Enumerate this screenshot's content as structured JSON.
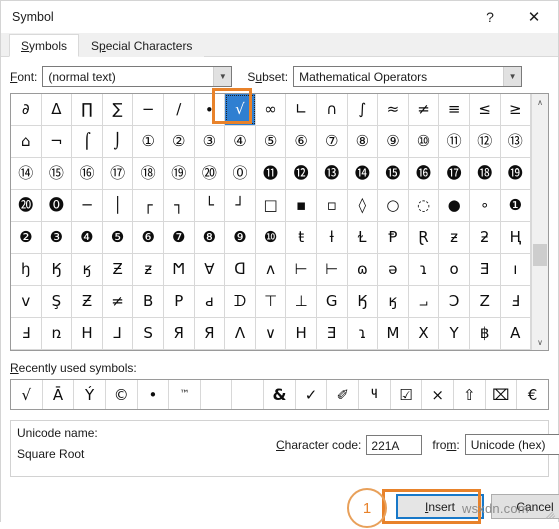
{
  "window": {
    "title": "Symbol",
    "help_icon": "?",
    "close_icon": "✕"
  },
  "tabs": [
    {
      "label": "Symbols",
      "accel": "S",
      "active": true
    },
    {
      "label": "Special Characters",
      "accel": "p",
      "active": false
    }
  ],
  "font_row": {
    "font_label": "Font:",
    "font_accel": "F",
    "font_value": "(normal text)",
    "subset_label": "Subset:",
    "subset_accel": "u",
    "subset_value": "Mathematical Operators",
    "dropdown_icon": "chevron-down-icon"
  },
  "grid": {
    "selected_index": 7,
    "scrollbar": {
      "up_icon": "∧",
      "down_icon": "∨",
      "thumb_position_pct": 60
    },
    "rows": [
      [
        "∂",
        "Δ",
        "∏",
        "∑",
        "−",
        "∕",
        "∙",
        "√",
        "∞",
        "∟",
        "∩",
        "∫",
        "≈",
        "≠",
        "≡",
        "≤",
        "≥"
      ],
      [
        "⌂",
        "¬",
        "⌠",
        "⌡",
        "①",
        "②",
        "③",
        "④",
        "⑤",
        "⑥",
        "⑦",
        "⑧",
        "⑨",
        "⑩",
        "⑪",
        "⑫",
        "⑬"
      ],
      [
        "⑭",
        "⑮",
        "⑯",
        "⑰",
        "⑱",
        "⑲",
        "⑳",
        "⓪",
        "⓫",
        "⓬",
        "⓭",
        "⓮",
        "⓯",
        "⓰",
        "⓱",
        "⓲",
        "⓳"
      ],
      [
        "⓴",
        "⓿",
        "─",
        "│",
        "┌",
        "┐",
        "└",
        "┘",
        "□",
        "▪",
        "▫",
        "◊",
        "○",
        "◌",
        "●",
        "∘",
        "❶"
      ],
      [
        "❷",
        "❸",
        "❹",
        "❺",
        "❻",
        "❼",
        "❽",
        "❾",
        "❿",
        "ŧ",
        "ƚ",
        "Ɫ",
        "Ᵽ",
        "Ɽ",
        "ƶ",
        "ƻ",
        "Ң"
      ],
      [
        "ꜧ",
        "Ӄ",
        "ӄ",
        "Ƶ",
        "ƶ",
        "Ϻ",
        "∀",
        "ᗡ",
        "ʌ",
        "⊢",
        "⊢",
        "ɷ",
        "ǝ",
        "ɿ",
        "ᴏ",
        "Ǝ",
        "ı"
      ],
      [
        "ᴠ",
        "Ş",
        "Ƶ",
        "≠",
        "B",
        "P",
        "ԁ",
        "ᗪ",
        "⊤",
        "⊥",
        "G",
        "Ӄ",
        "ӄ",
        "⨼",
        "Ↄ",
        "Z",
        "Ⅎ"
      ],
      [
        "Ⅎ",
        "ռ",
        "Н",
        "⅃",
        "S",
        "Я",
        "Я",
        "Λ",
        "∨",
        "H",
        "Ǝ",
        "ɿ",
        "M",
        "X",
        "Y",
        "฿",
        "A"
      ]
    ]
  },
  "recent": {
    "label": "Recently used symbols:",
    "accel": "R",
    "symbols": [
      "√",
      "Ā",
      "Ý",
      "©",
      "•",
      "™",
      "",
      "",
      "&",
      "✓",
      "✐",
      "౺",
      "☑",
      "×",
      "⇧",
      "⌧",
      "€"
    ]
  },
  "info": {
    "unicode_name_label": "Unicode name:",
    "unicode_name_value": "Square Root",
    "charcode_label": "Character code:",
    "charcode_accel": "C",
    "charcode_value": "221A",
    "from_label": "from:",
    "from_accel": "m",
    "from_value": "Unicode (hex)"
  },
  "footer": {
    "insert_label": "Insert",
    "insert_accel": "I",
    "cancel_label": "Cancel"
  },
  "annotations": {
    "step_number": "1",
    "accent_color": "#e8822a",
    "focus_color": "#1878c8"
  },
  "watermark": "wsxdn.com"
}
